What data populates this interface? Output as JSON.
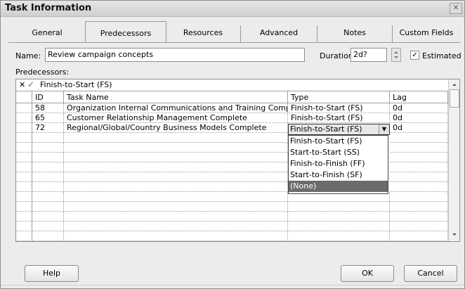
{
  "window": {
    "title": "Task Information",
    "close_glyph": "✕"
  },
  "tabs": [
    {
      "label": "General"
    },
    {
      "label": "Predecessors",
      "active": true
    },
    {
      "label": "Resources"
    },
    {
      "label": "Advanced"
    },
    {
      "label": "Notes"
    },
    {
      "label": "Custom Fields"
    }
  ],
  "form": {
    "name_label": "Name:",
    "name_value": "Review campaign concepts",
    "duration_label": "Duration:",
    "duration_value": "2d?",
    "estimated_label": "Estimated",
    "estimated_checked": true,
    "predecessors_label": "Predecessors:"
  },
  "grid": {
    "entry_value": "Finish-to-Start (FS)",
    "cancel_glyph": "✕",
    "accept_glyph": "✓",
    "columns": [
      "ID",
      "Task Name",
      "Type",
      "Lag"
    ],
    "rows": [
      {
        "id": "58",
        "name": "Organization Internal Communications and Training Complet",
        "type": "Finish-to-Start (FS)",
        "lag": "0d"
      },
      {
        "id": "65",
        "name": "Customer Relationship Management Complete",
        "type": "Finish-to-Start (FS)",
        "lag": "0d"
      },
      {
        "id": "72",
        "name": "Regional/Global/Country Business Models Complete",
        "type": "Finish-to-Start (FS)",
        "lag": "0d"
      }
    ],
    "dropdown_options": [
      {
        "label": "Finish-to-Start (FS)"
      },
      {
        "label": "Start-to-Start (SS)"
      },
      {
        "label": "Finish-to-Finish (FF)"
      },
      {
        "label": "Start-to-Finish (SF)"
      },
      {
        "label": "(None)",
        "highlighted": true
      }
    ]
  },
  "buttons": {
    "help": "Help",
    "ok": "OK",
    "cancel": "Cancel"
  }
}
